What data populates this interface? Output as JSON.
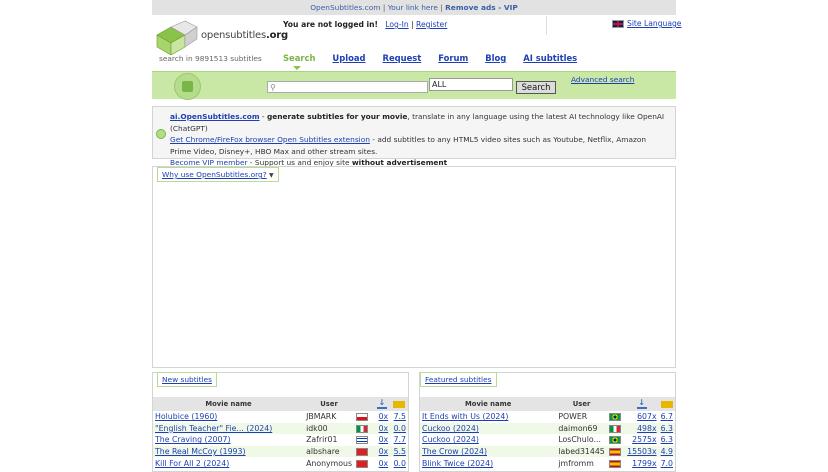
{
  "topbar": {
    "site": "OpenSubtitles.com",
    "link": "Your link here",
    "sep": "|",
    "vip": "Remove ads - VIP"
  },
  "header": {
    "logo_text": "opensubtitles",
    "logo_tld": ".org",
    "count": "search in 9891513 subtitles",
    "not_logged": "You are not logged in!",
    "login": "Log-In",
    "sep": "|",
    "register": "Register",
    "site_language": "Site Language"
  },
  "nav": [
    {
      "label": "Search",
      "active": true
    },
    {
      "label": "Upload"
    },
    {
      "label": "Request"
    },
    {
      "label": "Forum"
    },
    {
      "label": "Blog"
    },
    {
      "label": "AI subtitles"
    }
  ],
  "search": {
    "input_value": "",
    "lang_value": "ALL",
    "button": "Search",
    "advanced": "Advanced search"
  },
  "promo": {
    "line1_link": "ai.OpenSubtitles.com",
    "line1_dash": " - ",
    "line1_bold": "generate subtitles for your movie",
    "line1_rest": ", translate in any language using the latest AI technology like OpenAI (ChatGPT)",
    "line2_link": "Get Chrome/FireFox browser Open Subtitles extension",
    "line2_rest": " - add subtitles to any HTML5 video sites such as Youtube, Netflix, Amazon Prime Video, Disney+, HBO Max and other stream sites.",
    "line3_link": "Become VIP member",
    "line3_rest": " - Support us and enjoy site ",
    "line3_bold": "without advertisement"
  },
  "why": {
    "label": "Why use OpenSubtitles.org?"
  },
  "new_subtitles": {
    "title": "New subtitles",
    "headers": {
      "movie": "Movie name",
      "user": "User"
    },
    "rows": [
      {
        "movie": "Holubice (1960)",
        "user": "JBMARK",
        "flag": "cz",
        "downloads": "0x",
        "rating": "7.5"
      },
      {
        "movie": "\"English Teacher\" Fie... (2024)",
        "user": "idk00",
        "flag": "it",
        "downloads": "0x",
        "rating": "0.0"
      },
      {
        "movie": "The Craving (2007)",
        "user": "Zafrir01",
        "flag": "il",
        "downloads": "0x",
        "rating": "7.7"
      },
      {
        "movie": "The Real McCoy (1993)",
        "user": "albshare",
        "flag": "al",
        "downloads": "0x",
        "rating": "5.5"
      },
      {
        "movie": "Kill For All 2 (2024)",
        "user": "Anonymous",
        "flag": "al",
        "downloads": "0x",
        "rating": "0.0"
      }
    ]
  },
  "featured_subtitles": {
    "title": "Featured subtitles",
    "headers": {
      "movie": "Movie name",
      "user": "User"
    },
    "rows": [
      {
        "movie": "It Ends with Us (2024)",
        "user": "POWER",
        "flag": "br",
        "downloads": "607x",
        "rating": "6.7"
      },
      {
        "movie": "Cuckoo (2024)",
        "user": "daimon69",
        "flag": "it",
        "downloads": "498x",
        "rating": "6.3"
      },
      {
        "movie": "Cuckoo (2024)",
        "user": "LosChulo...",
        "flag": "br",
        "downloads": "2575x",
        "rating": "6.3"
      },
      {
        "movie": "The Crow (2024)",
        "user": "labed31445",
        "flag": "es",
        "downloads": "15503x",
        "rating": "4.9"
      },
      {
        "movie": "Blink Twice (2024)",
        "user": "jmfromm",
        "flag": "es",
        "downloads": "1799x",
        "rating": "7.0"
      }
    ]
  },
  "colors": {
    "green_band": "#c9e8a6",
    "link": "#1d3fb3",
    "active_nav": "#7ab548"
  }
}
